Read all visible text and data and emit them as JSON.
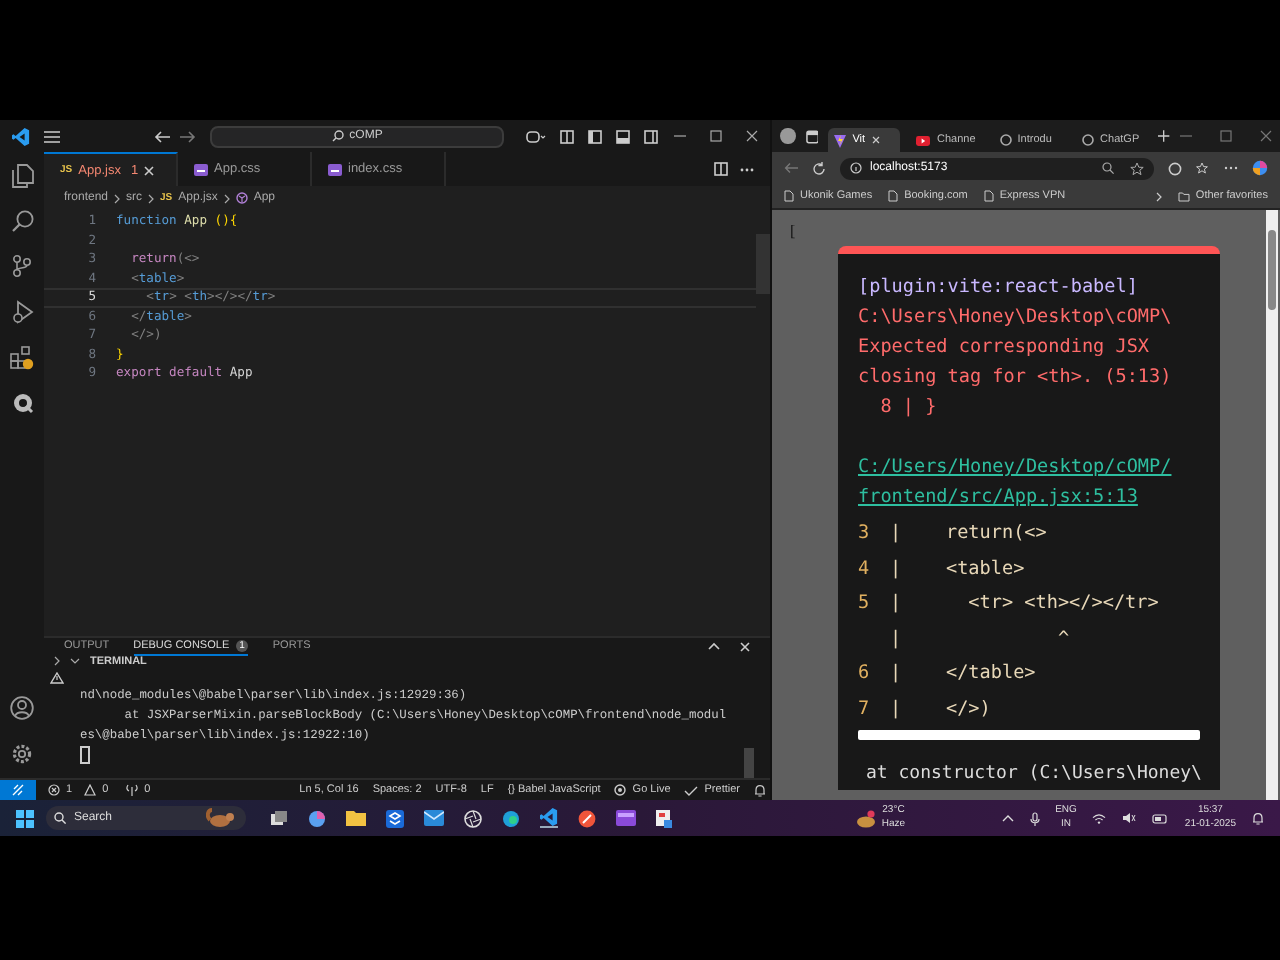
{
  "vscode": {
    "search": "cOMP",
    "tabs": [
      {
        "label": "App.jsx",
        "kind": "js",
        "icon_label": "JS",
        "selected": true,
        "has_error": true,
        "badge": "1"
      },
      {
        "label": "App.css",
        "kind": "css",
        "selected": false,
        "has_error": false
      },
      {
        "label": "index.css",
        "kind": "css",
        "selected": false,
        "has_error": false
      }
    ],
    "breadcrumbs": [
      {
        "label": "frontend",
        "kind": "folder"
      },
      {
        "label": "src",
        "kind": "folder"
      },
      {
        "label": "App.jsx",
        "kind": "js",
        "icon_label": "JS"
      },
      {
        "label": "App",
        "kind": "symbol"
      }
    ],
    "code": [
      {
        "number": "1",
        "current": false,
        "tokens": [
          {
            "text": "function",
            "kind": "storage"
          },
          {
            "text": " App",
            "kind": "name"
          },
          {
            "text": " (){",
            "kind": "brace"
          }
        ]
      },
      {
        "number": "2",
        "current": false
      },
      {
        "number": "3",
        "current": false,
        "tokens": [
          {
            "text": "  return",
            "kind": "keyword"
          },
          {
            "text": "(<>",
            "kind": "punct"
          }
        ]
      },
      {
        "number": "4",
        "current": false,
        "tokens": [
          {
            "text": "  <",
            "kind": "punct"
          },
          {
            "text": "table",
            "kind": "tag"
          },
          {
            "text": ">",
            "kind": "punct"
          }
        ]
      },
      {
        "number": "5",
        "current": true,
        "tokens": [
          {
            "text": "    <",
            "kind": "punct"
          },
          {
            "text": "tr",
            "kind": "tag"
          },
          {
            "text": "> <",
            "kind": "punct"
          },
          {
            "text": "th",
            "kind": "tag"
          },
          {
            "text": "></></",
            "kind": "punct"
          },
          {
            "text": "tr",
            "kind": "tag"
          },
          {
            "text": ">",
            "kind": "punct"
          }
        ]
      },
      {
        "number": "6",
        "current": false,
        "tokens": [
          {
            "text": "  </",
            "kind": "punct"
          },
          {
            "text": "table",
            "kind": "tag"
          },
          {
            "text": ">",
            "kind": "punct"
          }
        ]
      },
      {
        "number": "7",
        "current": false,
        "tokens": [
          {
            "text": "  </>)",
            "kind": "punct"
          }
        ]
      },
      {
        "number": "8",
        "current": false,
        "tokens": [
          {
            "text": "}",
            "kind": "brace"
          }
        ]
      },
      {
        "number": "9",
        "current": false,
        "tokens": [
          {
            "text": "export",
            "kind": "keyword"
          },
          {
            "text": " default",
            "kind": "keyword"
          },
          {
            "text": " App",
            "kind": "plain"
          }
        ]
      }
    ],
    "panel_tabs": [
      {
        "label": "OUTPUT",
        "selected": false
      },
      {
        "label": "DEBUG CONSOLE",
        "selected": true,
        "badge": "1"
      },
      {
        "label": "PORTS",
        "selected": false
      }
    ],
    "terminal_title": "TERMINAL",
    "terminal_lines": [
      "nd\\node_modules\\@babel\\parser\\lib\\index.js:12929:36)",
      "      at JSXParserMixin.parseBlockBody (C:\\Users\\Honey\\Desktop\\cOMP\\frontend\\node_modul",
      "es\\@babel\\parser\\lib\\index.js:12922:10)"
    ],
    "status": {
      "errors": "1",
      "warnings": "0",
      "ports": "0",
      "items": [
        "Ln 5, Col 16",
        "Spaces: 2",
        "UTF-8",
        "LF",
        "{} Babel JavaScript"
      ],
      "go_live": "Go Live",
      "prettier": "Prettier"
    }
  },
  "browser": {
    "tabs": [
      {
        "label": "Vit",
        "kind": "vite",
        "selected": true
      },
      {
        "label": "Channe",
        "kind": "video",
        "selected": false
      },
      {
        "label": "Introdu",
        "kind": "globe",
        "selected": false
      },
      {
        "label": "ChatGP",
        "kind": "globe",
        "selected": false
      }
    ],
    "url": "localhost:5173",
    "favorites": [
      "Ukonik Games",
      "Booking.com",
      "Express VPN"
    ],
    "other_favorites": "Other favorites",
    "page_text": "[",
    "error": {
      "plugin": "[plugin:vite:react-babel]",
      "message": [
        "C:\\Users\\Honey\\Desktop\\cOMP\\",
        "Expected corresponding JSX",
        "closing tag for <th>. (5:13)",
        "  8 | }"
      ],
      "file": [
        "C:/Users/Honey/Desktop/cOMP/",
        "frontend/src/App.jsx:5:13"
      ],
      "frame": [
        {
          "number": "3",
          "text": "|    return(<>"
        },
        {
          "number": "4",
          "text": "|    <table>"
        },
        {
          "number": "5",
          "text": "|      <tr> <th></></tr>"
        },
        {
          "text": "|              ^"
        },
        {
          "number": "6",
          "text": "|    </table>"
        },
        {
          "number": "7",
          "text": "|    </>)"
        }
      ],
      "stack": "at constructor (C:\\Users\\Honey\\"
    }
  },
  "taskbar": {
    "search": "Search",
    "temperature": "23°C",
    "weather": "Haze",
    "language": "ENG",
    "region": "IN",
    "time": "15:37",
    "date": "21-01-2025"
  }
}
